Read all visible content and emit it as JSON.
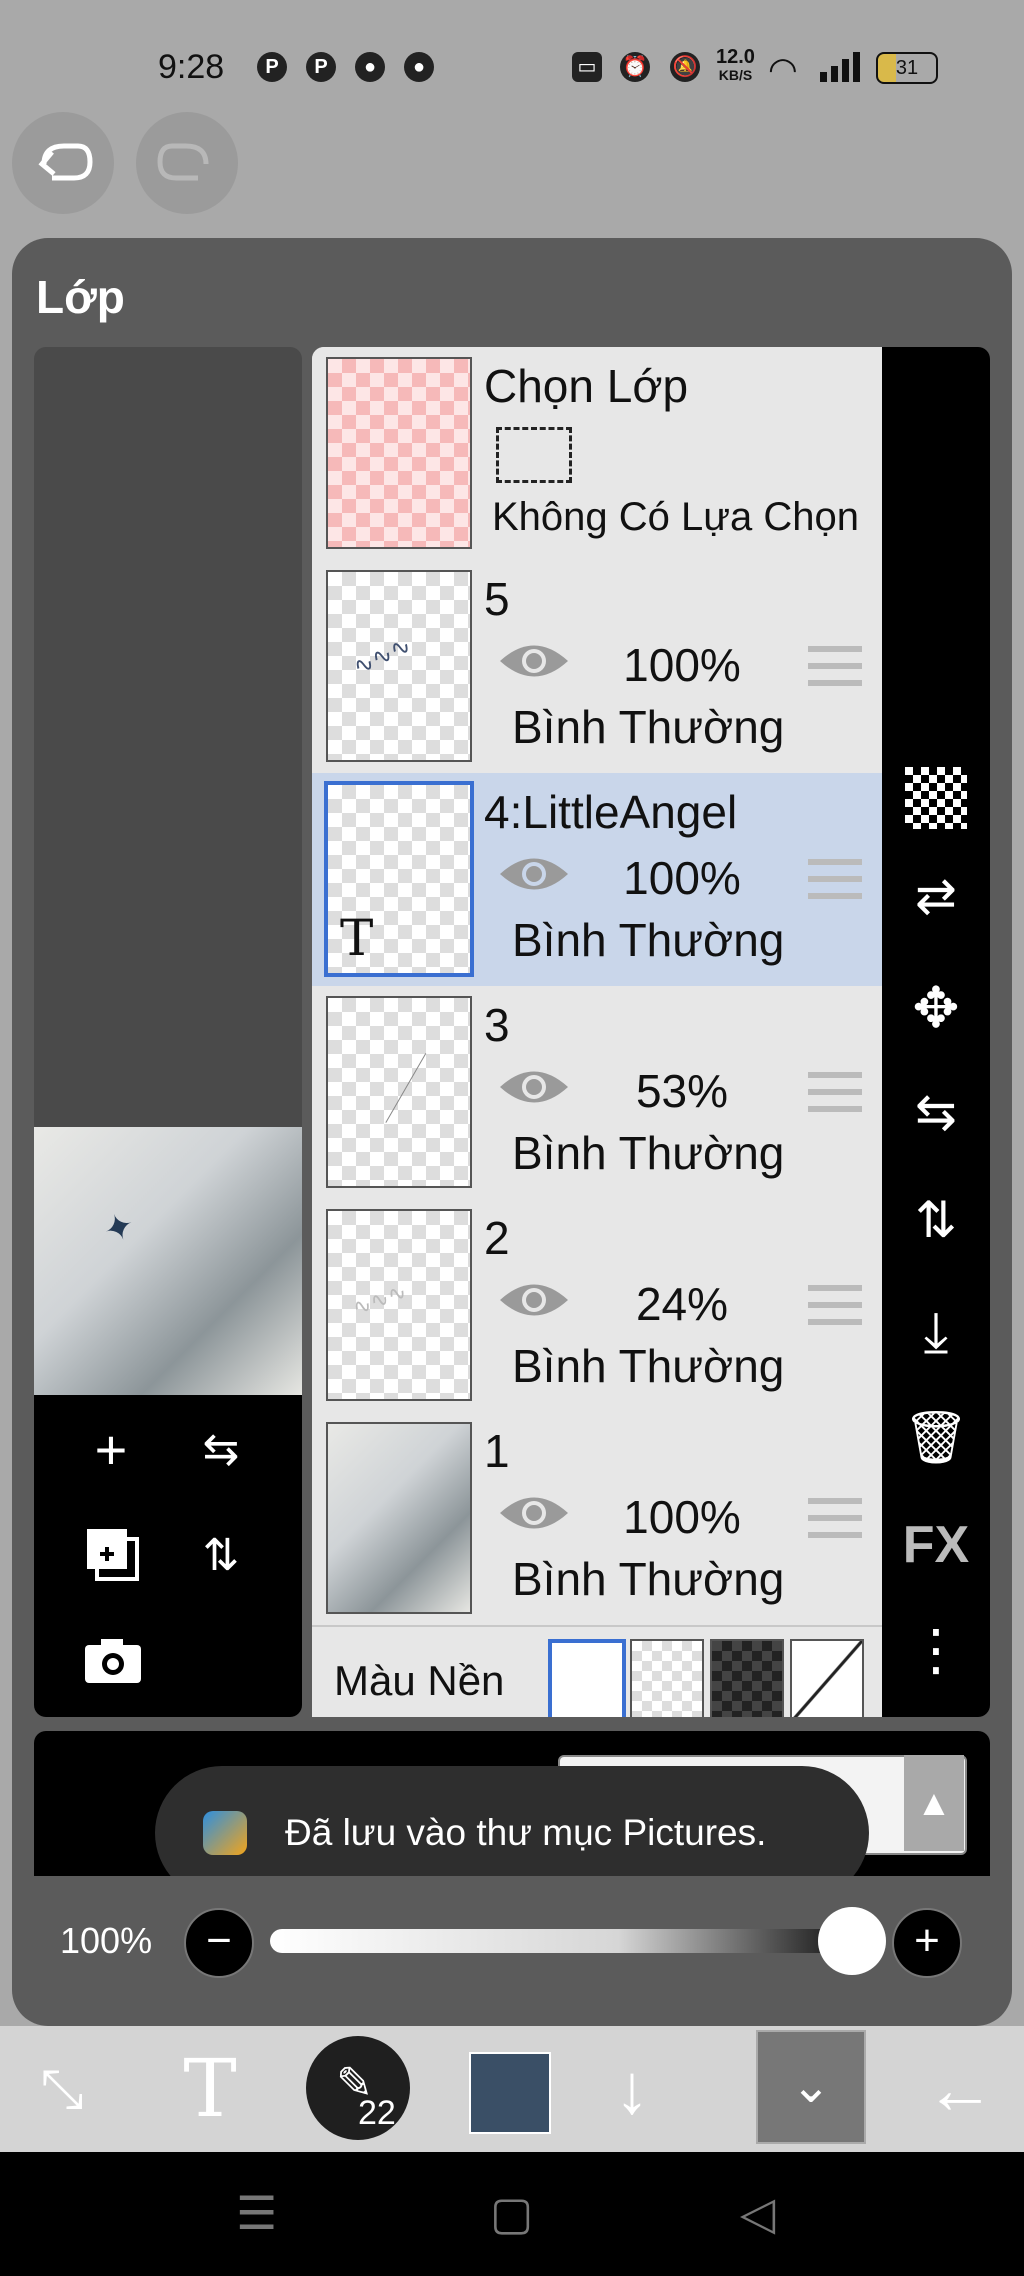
{
  "status_bar": {
    "time": "9:28",
    "left_icons": [
      "pinterest-icon",
      "pinterest-icon",
      "chrome-icon",
      "chrome-icon"
    ],
    "right_icons": [
      "cast-icon",
      "alarm-icon",
      "mute-icon",
      "network-speed",
      "wifi-icon",
      "signal-icon",
      "battery-icon"
    ],
    "speed_value": "12.0",
    "speed_unit": "KB/S",
    "battery": "31"
  },
  "history": {
    "undo_icon": "undo-icon",
    "redo_icon": "redo-icon"
  },
  "panel": {
    "title": "Lớp",
    "selection_layer": {
      "title": "Chọn Lớp",
      "status": "Không Có Lựa Chọn"
    },
    "layers": [
      {
        "name": "5",
        "opacity": "100%",
        "blend": "Bình Thường",
        "selected": false
      },
      {
        "name": "4:LittleAngel",
        "opacity": "100%",
        "blend": "Bình Thường",
        "selected": true
      },
      {
        "name": "3",
        "opacity": "53%",
        "blend": "Bình Thường",
        "selected": false
      },
      {
        "name": "2",
        "opacity": "24%",
        "blend": "Bình Thường",
        "selected": false
      },
      {
        "name": "1",
        "opacity": "100%",
        "blend": "Bình Thường",
        "selected": false
      }
    ],
    "text_layer_marker": "T",
    "background_label": "Màu Nền",
    "right_tools": [
      "checker-icon",
      "transfer-icon",
      "move-icon",
      "flip-horizontal-icon",
      "flip-vertical-icon",
      "merge-down-icon",
      "trash-icon",
      "FX",
      "more-icon"
    ],
    "fx_label": "FX",
    "left_tools": [
      "add-layer-icon",
      "flip-horizontal-icon",
      "add-copy-icon",
      "flip-vertical-icon",
      "camera-icon"
    ]
  },
  "toast": {
    "message": "Đã lưu vào thư mục Pictures."
  },
  "opacity_row": {
    "value": "100%",
    "minus": "−",
    "plus": "+"
  },
  "toolbar": {
    "brush_size": "22",
    "color": "#3a4f66",
    "items": [
      "transform-icon",
      "text-tool-icon",
      "brush-icon",
      "color-swatch",
      "arrow-down-icon",
      "chevron-down-icon",
      "back-arrow-icon"
    ]
  },
  "nav_bar": {
    "items": [
      "menu-icon",
      "home-icon",
      "back-icon"
    ]
  }
}
